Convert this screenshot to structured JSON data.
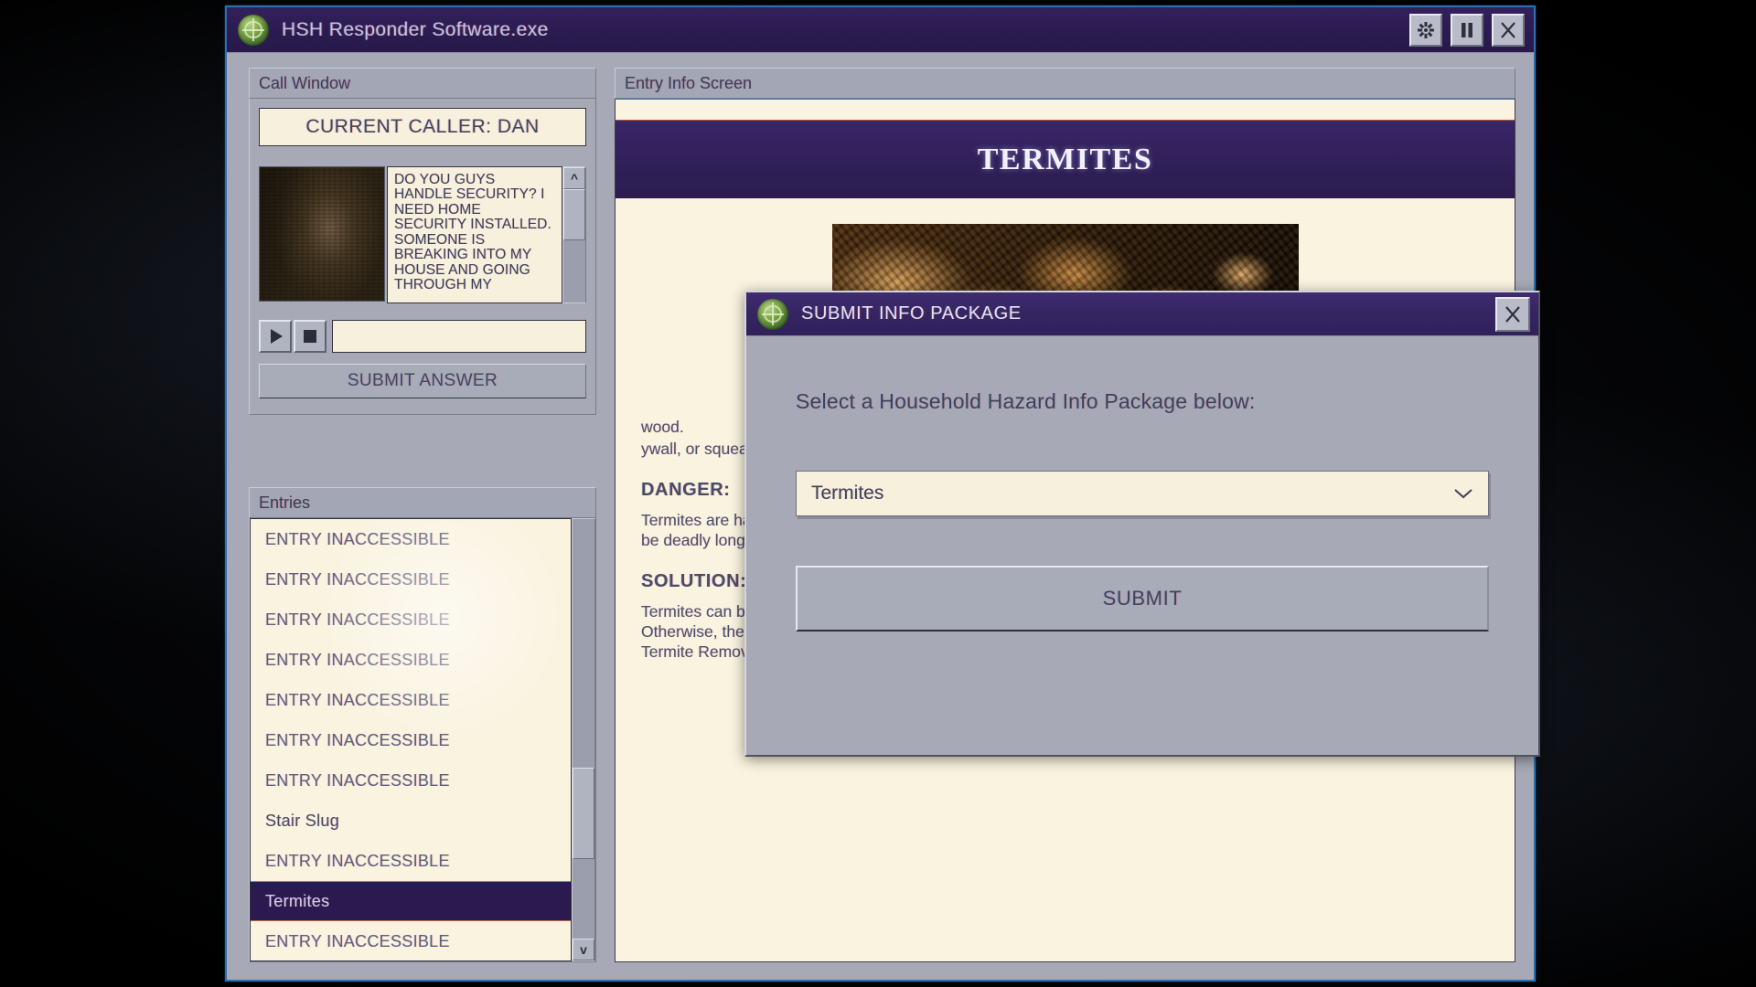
{
  "window": {
    "title": "HSH Responder Software.exe",
    "logo_icon": "hsh-globe-logo",
    "controls": [
      {
        "name": "settings-button",
        "icon": "gear-icon"
      },
      {
        "name": "pause-button",
        "icon": "pause-icon"
      },
      {
        "name": "close-button",
        "icon": "close-icon"
      }
    ]
  },
  "call_window": {
    "panel_title": "Call Window",
    "caller_banner": "CURRENT CALLER: DAN",
    "transcript": "DO YOU GUYS HANDLE SECURITY? I NEED HOME SECURITY INSTALLED. SOMEONE IS BREAKING INTO MY HOUSE AND GOING THROUGH MY",
    "play_icon": "play-icon",
    "stop_icon": "stop-icon",
    "audio_field_value": "",
    "submit_answer_label": "SUBMIT ANSWER",
    "scroll_up_glyph": "^"
  },
  "entries": {
    "panel_title": "Entries",
    "scroll_down_glyph": "v",
    "items": [
      {
        "label": "ENTRY INACCESSIBLE",
        "accessible": false,
        "selected": false
      },
      {
        "label": "ENTRY INACCESSIBLE",
        "accessible": false,
        "selected": false
      },
      {
        "label": "ENTRY INACCESSIBLE",
        "accessible": false,
        "selected": false
      },
      {
        "label": "ENTRY INACCESSIBLE",
        "accessible": false,
        "selected": false
      },
      {
        "label": "ENTRY INACCESSIBLE",
        "accessible": false,
        "selected": false
      },
      {
        "label": "ENTRY INACCESSIBLE",
        "accessible": false,
        "selected": false
      },
      {
        "label": "ENTRY INACCESSIBLE",
        "accessible": false,
        "selected": false
      },
      {
        "label": "Stair Slug",
        "accessible": true,
        "selected": false
      },
      {
        "label": "ENTRY INACCESSIBLE",
        "accessible": false,
        "selected": false
      },
      {
        "label": "Termites",
        "accessible": true,
        "selected": true
      },
      {
        "label": "ENTRY INACCESSIBLE",
        "accessible": false,
        "selected": false
      }
    ]
  },
  "info_screen": {
    "panel_title": "Entry Info Screen",
    "banner_title": "TERMITES",
    "image_alt": "termite-colony-photo",
    "occluded_line_1": "wood.",
    "occluded_line_2": "ywall, or squeaky",
    "sections": [
      {
        "heading": "DANGER:",
        "body": "Termites are harmless to humans by themselves, but the damage they can cause to a house's structural integrity can be deadly long–term, and should be removed as soon as possible."
      },
      {
        "heading": "SOLUTION:",
        "body": "Termites can be removed using common pesticides, but the treatment must be thorough and destroy the entire colony. Otherwise, they will quickly repopulate and resume their activity. It is highly advised to utilize HSH's Professional Termite Removal services."
      }
    ]
  },
  "modal": {
    "title": "SUBMIT INFO PACKAGE",
    "logo_icon": "hsh-globe-logo",
    "close_icon": "close-icon",
    "prompt": "Select a Household Hazard Info Package below:",
    "selected_package": "Termites",
    "dropdown_icon": "chevron-down-icon",
    "submit_label": "SUBMIT"
  },
  "colors": {
    "accent_purple": "#2f1f57",
    "window_chrome": "#a7a9b6",
    "parchment": "#faf3e0",
    "frame_blue": "#2d6fb0"
  }
}
